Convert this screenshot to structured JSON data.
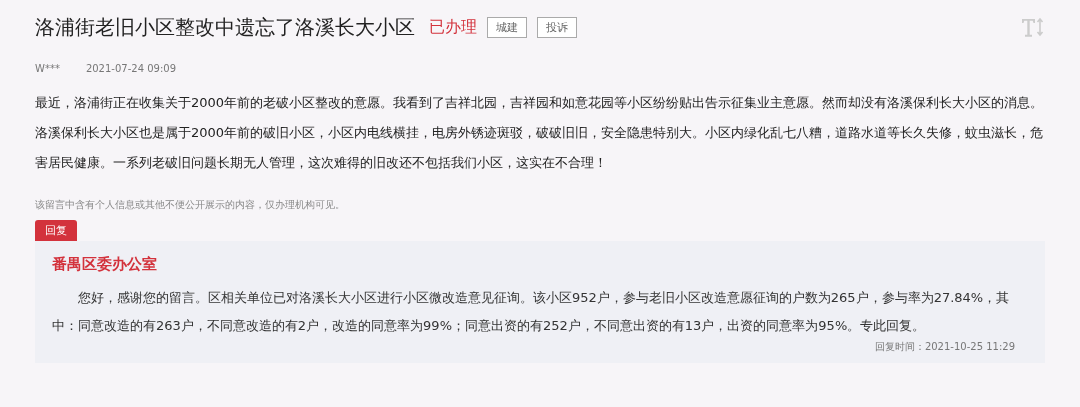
{
  "post": {
    "title": "洛浦街老旧小区整改中遗忘了洛溪长大小区",
    "status": "已办理",
    "tags": [
      "城建",
      "投诉"
    ],
    "author": "W***",
    "time": "2021-07-24 09:09",
    "body": "最近，洛浦街正在收集关于2000年前的老破小区整改的意愿。我看到了吉祥北园，吉祥园和如意花园等小区纷纷贴出告示征集业主意愿。然而却没有洛溪保利长大小区的消息。洛溪保利长大小区也是属于2000年前的破旧小区，小区内电线横挂，电房外锈迹斑驳，破破旧旧，安全隐患特别大。小区内绿化乱七八糟，道路水道等长久失修，蚊虫滋长，危害居民健康。一系列老破旧问题长期无人管理，这次难得的旧改还不包括我们小区，这实在不合理！",
    "privacy_note": "该留言中含有个人信息或其他不便公开展示的内容，仅办理机构可见。"
  },
  "reply": {
    "tab": "回复",
    "department": "番禺区委办公室",
    "body": "您好，感谢您的留言。区相关单位已对洛溪长大小区进行小区微改造意见征询。该小区952户，参与老旧小区改造意愿征询的户数为265户，参与率为27.84%，其中：同意改造的有263户，不同意改造的有2户，改造的同意率为99%；同意出资的有252户，不同意出资的有13户，出资的同意率为95%。专此回复。",
    "time": "回复时间：2021-10-25 11:29"
  }
}
